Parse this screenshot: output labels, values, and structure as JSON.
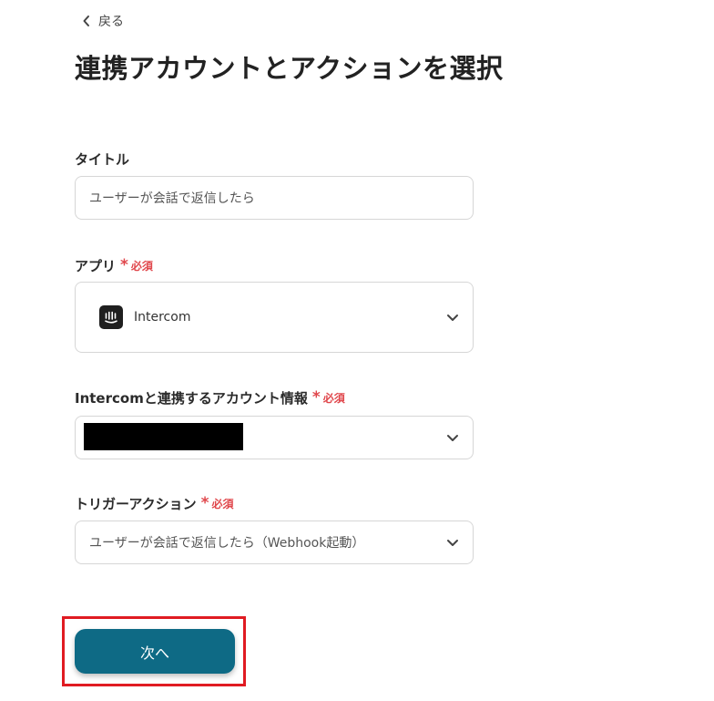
{
  "nav": {
    "back_label": "戻る"
  },
  "page": {
    "title": "連携アカウントとアクションを選択"
  },
  "required_text": "必須",
  "required_mark": "*",
  "fields": {
    "title": {
      "label": "タイトル",
      "value": "ユーザーが会話で返信したら"
    },
    "app": {
      "label": "アプリ",
      "selected": "Intercom",
      "icon": "intercom-logo-icon"
    },
    "account": {
      "label": "Intercomと連携するアカウント情報",
      "note": "selected account name is redacted"
    },
    "trigger": {
      "label": "トリガーアクション",
      "selected": "ユーザーが会話で返信したら（Webhook起動）"
    }
  },
  "actions": {
    "next_label": "次へ"
  },
  "colors": {
    "primary": "#0e6a85",
    "required": "#e0474c",
    "highlight": "#e01b22"
  }
}
